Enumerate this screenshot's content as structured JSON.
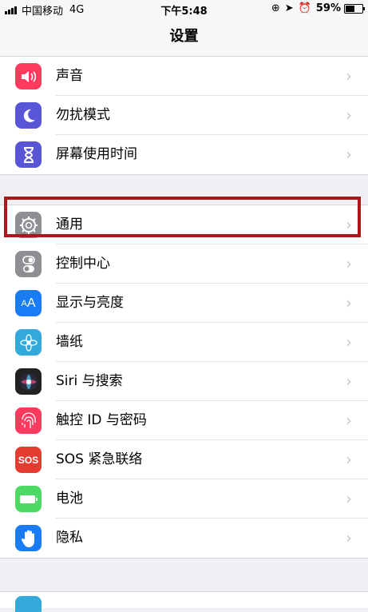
{
  "status_bar": {
    "carrier": "中国移动",
    "network": "4G",
    "time": "下午5:48",
    "battery_percent": "59%",
    "battery_level": 0.59
  },
  "nav": {
    "title": "设置"
  },
  "groups": [
    {
      "items": [
        {
          "label": "声音",
          "icon": "speaker-icon",
          "color": "#fe3b5f"
        },
        {
          "label": "勿扰模式",
          "icon": "moon-icon",
          "color": "#5856d6"
        },
        {
          "label": "屏幕使用时间",
          "icon": "hourglass-icon",
          "color": "#5856d6"
        }
      ]
    },
    {
      "items": [
        {
          "label": "通用",
          "icon": "gear-icon",
          "color": "#8e8e93"
        },
        {
          "label": "控制中心",
          "icon": "toggle-icon",
          "color": "#8e8e93"
        },
        {
          "label": "显示与亮度",
          "icon": "text-size-icon",
          "color": "#1a7cf5"
        },
        {
          "label": "墙纸",
          "icon": "flower-icon",
          "color": "#34aadc"
        },
        {
          "label": "Siri 与搜索",
          "icon": "siri-icon",
          "color": "#222222"
        },
        {
          "label": "触控 ID 与密码",
          "icon": "fingerprint-icon",
          "color": "#fe3b5f"
        },
        {
          "label": "SOS 紧急联络",
          "icon": "sos-icon",
          "color": "#e53b30",
          "icon_text": "SOS"
        },
        {
          "label": "电池",
          "icon": "battery-icon",
          "color": "#4cd964"
        },
        {
          "label": "隐私",
          "icon": "hand-icon",
          "color": "#1a7cf5"
        }
      ]
    }
  ],
  "chevron": "›"
}
